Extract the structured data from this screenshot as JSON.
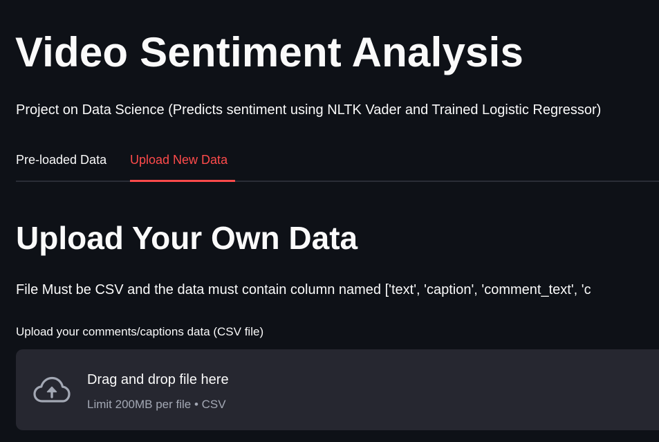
{
  "header": {
    "title": "Video Sentiment Analysis",
    "subtitle": "Project on Data Science (Predicts sentiment using NLTK Vader and Trained Logistic Regressor)"
  },
  "tabs": [
    {
      "label": "Pre-loaded Data",
      "active": false
    },
    {
      "label": "Upload New Data",
      "active": true
    }
  ],
  "upload_section": {
    "title": "Upload Your Own Data",
    "hint": "File Must be CSV and the data must contain column named ['text', 'caption', 'comment_text', 'c",
    "uploader": {
      "label": "Upload your comments/captions data (CSV file)",
      "drop_title": "Drag and drop file here",
      "limit_text": "Limit 200MB per file • CSV",
      "icon": "cloud-upload-icon"
    }
  },
  "colors": {
    "background": "#0e1117",
    "text": "#fafafa",
    "accent": "#ff4b4b",
    "muted_text": "#a3a8b4",
    "dropzone_bg": "#262730"
  }
}
